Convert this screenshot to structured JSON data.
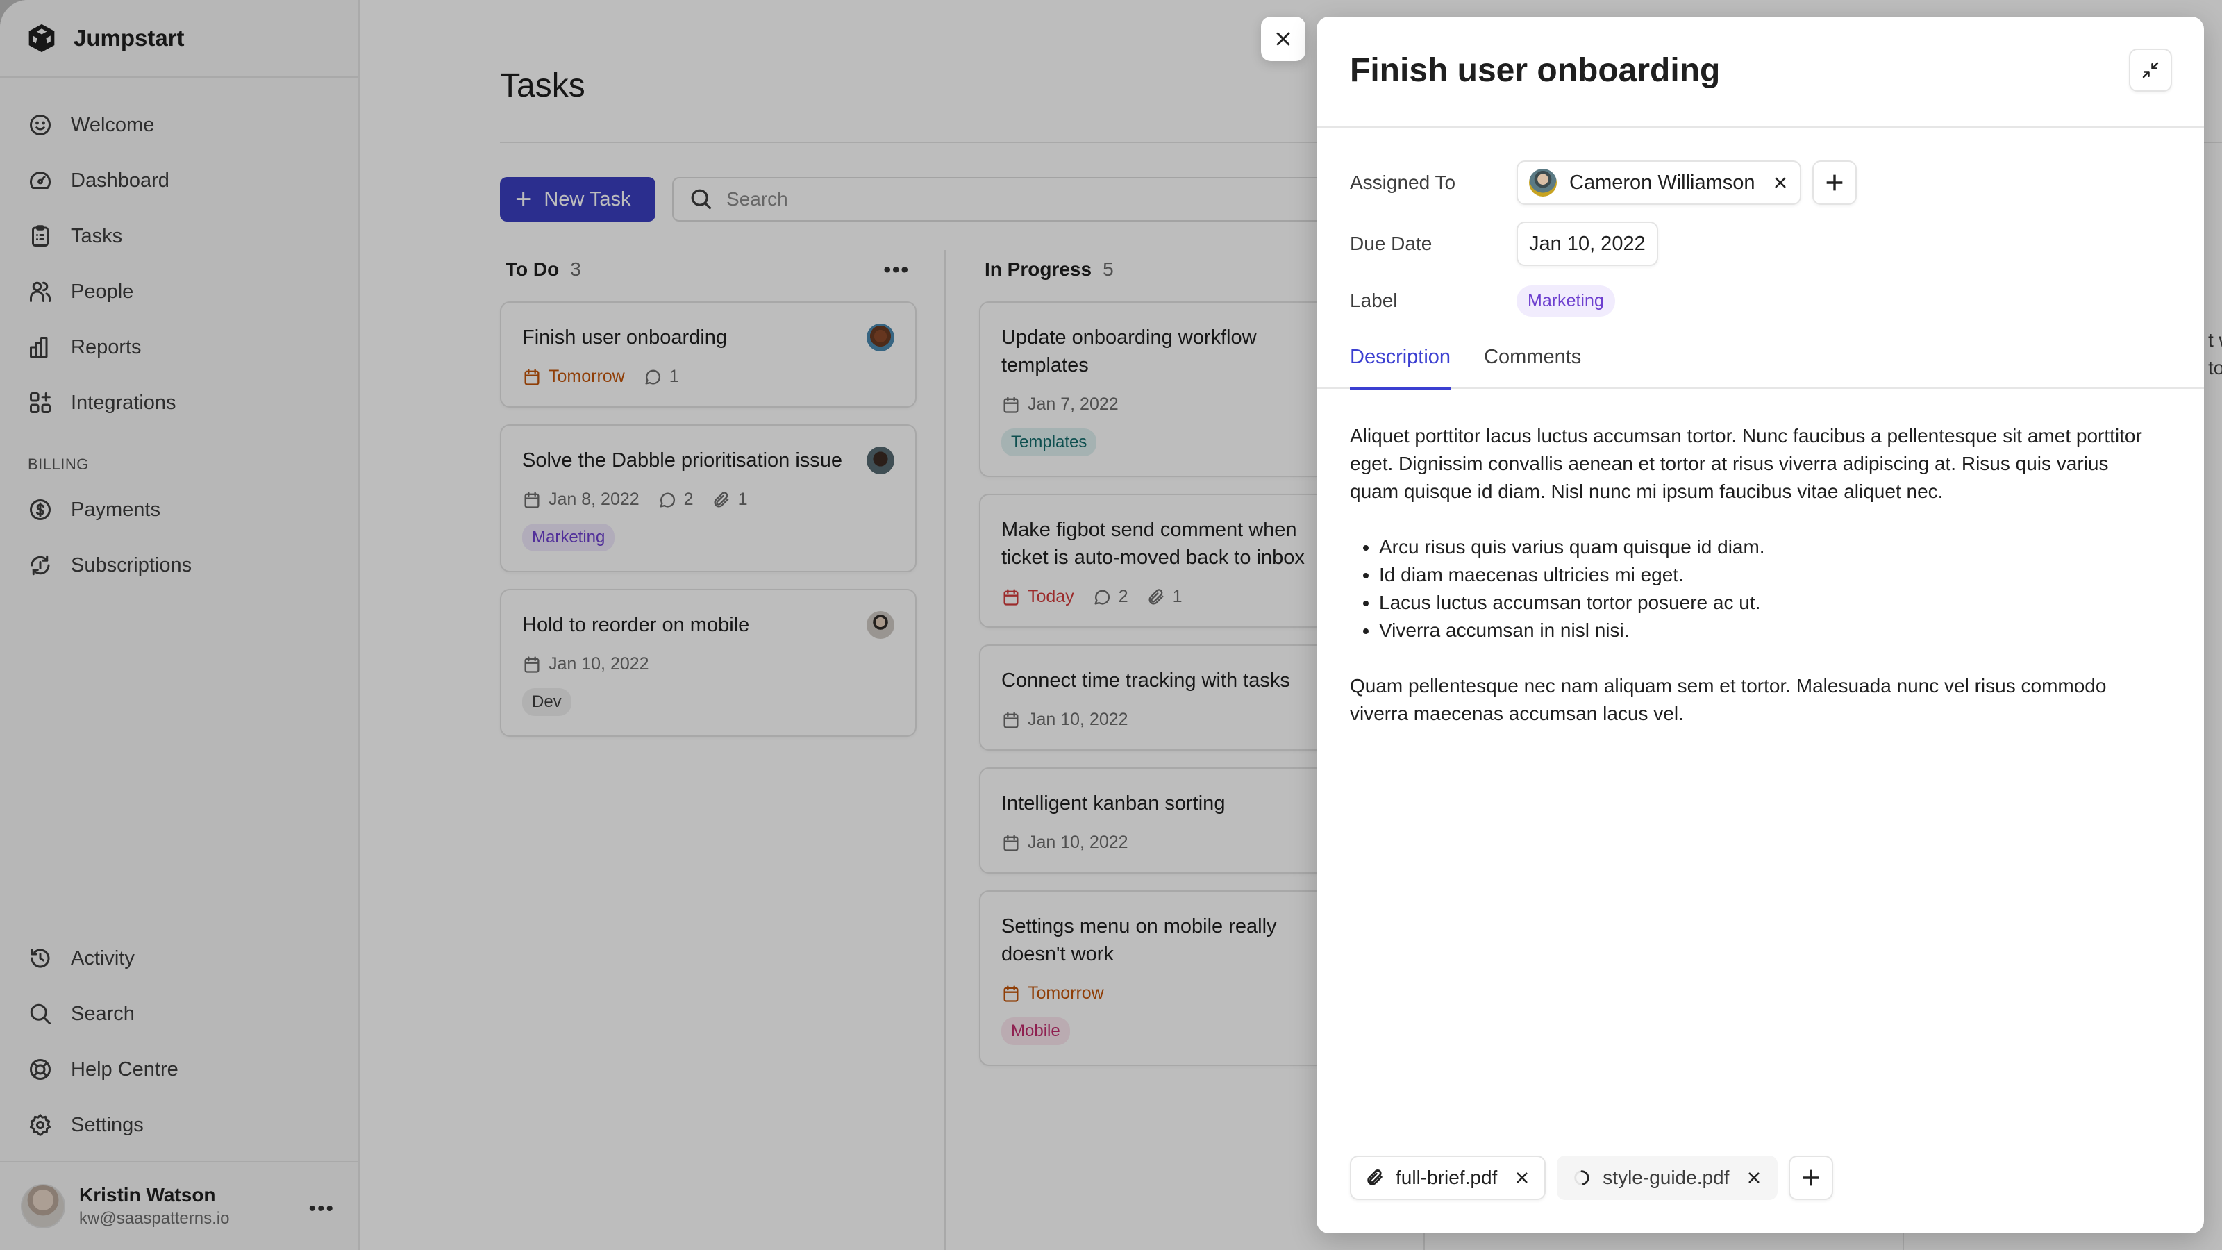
{
  "app": {
    "name": "Jumpstart"
  },
  "sidebar": {
    "items": [
      {
        "label": "Welcome",
        "icon": "smile-icon"
      },
      {
        "label": "Dashboard",
        "icon": "gauge-icon"
      },
      {
        "label": "Tasks",
        "icon": "clipboard-icon"
      },
      {
        "label": "People",
        "icon": "users-icon"
      },
      {
        "label": "Reports",
        "icon": "bar-chart-icon"
      },
      {
        "label": "Integrations",
        "icon": "grid-plus-icon"
      }
    ],
    "billing_section": "BILLING",
    "billing_items": [
      {
        "label": "Payments",
        "icon": "dollar-circle-icon"
      },
      {
        "label": "Subscriptions",
        "icon": "refresh-dollar-icon"
      }
    ],
    "bottom_items": [
      {
        "label": "Activity",
        "icon": "history-icon"
      },
      {
        "label": "Search",
        "icon": "search-icon"
      },
      {
        "label": "Help Centre",
        "icon": "lifebuoy-icon"
      },
      {
        "label": "Settings",
        "icon": "gear-icon"
      }
    ],
    "user": {
      "name": "Kristin Watson",
      "email": "kw@saaspatterns.io",
      "more": "•••"
    }
  },
  "main": {
    "title": "Tasks",
    "new_task_label": "New Task",
    "search_placeholder": "Search",
    "columns": [
      {
        "name": "To Do",
        "count": "3",
        "more": "•••",
        "cards": [
          {
            "title": "Finish user onboarding",
            "due": "Tomorrow",
            "comments": "1"
          },
          {
            "title": "Solve the Dabble prioritisation issue",
            "due": "Jan 8, 2022",
            "comments": "2",
            "attachments": "1",
            "tag": "Marketing"
          },
          {
            "title": "Hold to reorder on mobile",
            "due": "Jan 10, 2022",
            "tag": "Dev"
          }
        ]
      },
      {
        "name": "In Progress",
        "count": "5",
        "cards": [
          {
            "title": "Update onboarding workflow templates",
            "due": "Jan 7, 2022",
            "tag": "Templates"
          },
          {
            "title": "Make figbot send comment when ticket is auto-moved back to inbox",
            "due": "Today",
            "comments": "2",
            "attachments": "1"
          },
          {
            "title": "Connect time tracking with tasks",
            "due": "Jan 10, 2022"
          },
          {
            "title": "Intelligent kanban sorting",
            "due": "Jan 10, 2022"
          },
          {
            "title": "Settings menu on mobile really doesn't work",
            "due": "Tomorrow",
            "tag": "Mobile"
          }
        ]
      }
    ],
    "peek_lines": [
      "t w",
      "to"
    ]
  },
  "panel": {
    "title": "Finish user onboarding",
    "fields": {
      "assigned_label": "Assigned To",
      "assignee": "Cameron Williamson",
      "due_label": "Due Date",
      "due_value": "Jan 10, 2022",
      "label_label": "Label",
      "label_value": "Marketing"
    },
    "tabs": [
      {
        "label": "Description",
        "active": true
      },
      {
        "label": "Comments",
        "active": false
      }
    ],
    "description": {
      "p1": "Aliquet porttitor lacus luctus accumsan tortor. Nunc faucibus a pellentesque sit amet porttitor eget. Dignissim convallis aenean et tortor at risus viverra adipiscing at. Risus quis varius quam quisque id diam. Nisl nunc mi ipsum faucibus vitae aliquet nec.",
      "bullets": [
        "Arcu risus quis varius quam quisque id diam.",
        "Id diam maecenas ultricies mi eget.",
        "Lacus luctus accumsan tortor posuere ac ut.",
        "Viverra accumsan in nisl nisi."
      ],
      "p2": "Quam pellentesque nec nam aliquam sem et tortor. Malesuada nunc vel risus commodo viverra maecenas accumsan lacus vel."
    },
    "attachments": [
      {
        "name": "full-brief.pdf",
        "state": "uploaded"
      },
      {
        "name": "style-guide.pdf",
        "state": "uploading"
      }
    ]
  },
  "colors": {
    "accent": "#3b3fd1",
    "primary_button": "#3a3fc0",
    "due_tomorrow": "#c2540a",
    "due_today": "#d23b3b",
    "tag_marketing": "#6d3fcf",
    "tag_templates": "#136b6b",
    "tag_mobile": "#c12b6c"
  }
}
